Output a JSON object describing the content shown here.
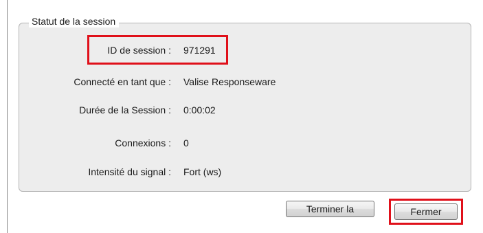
{
  "session_status": {
    "title": "Statut de la session",
    "fields": [
      {
        "label": "ID de session :",
        "value": "971291"
      },
      {
        "label": "Connecté en tant que :",
        "value": "Valise Responseware"
      },
      {
        "label": "Durée de la Session :",
        "value": "0:00:02"
      },
      {
        "label": "Connexions :",
        "value": "0"
      },
      {
        "label": "Intensité du signal :",
        "value": "Fort (ws)"
      }
    ]
  },
  "buttons": {
    "end_label": "Terminer la",
    "close_label": "Fermer"
  },
  "colors": {
    "highlight": "#e0101a",
    "panel_background": "#ededed"
  }
}
